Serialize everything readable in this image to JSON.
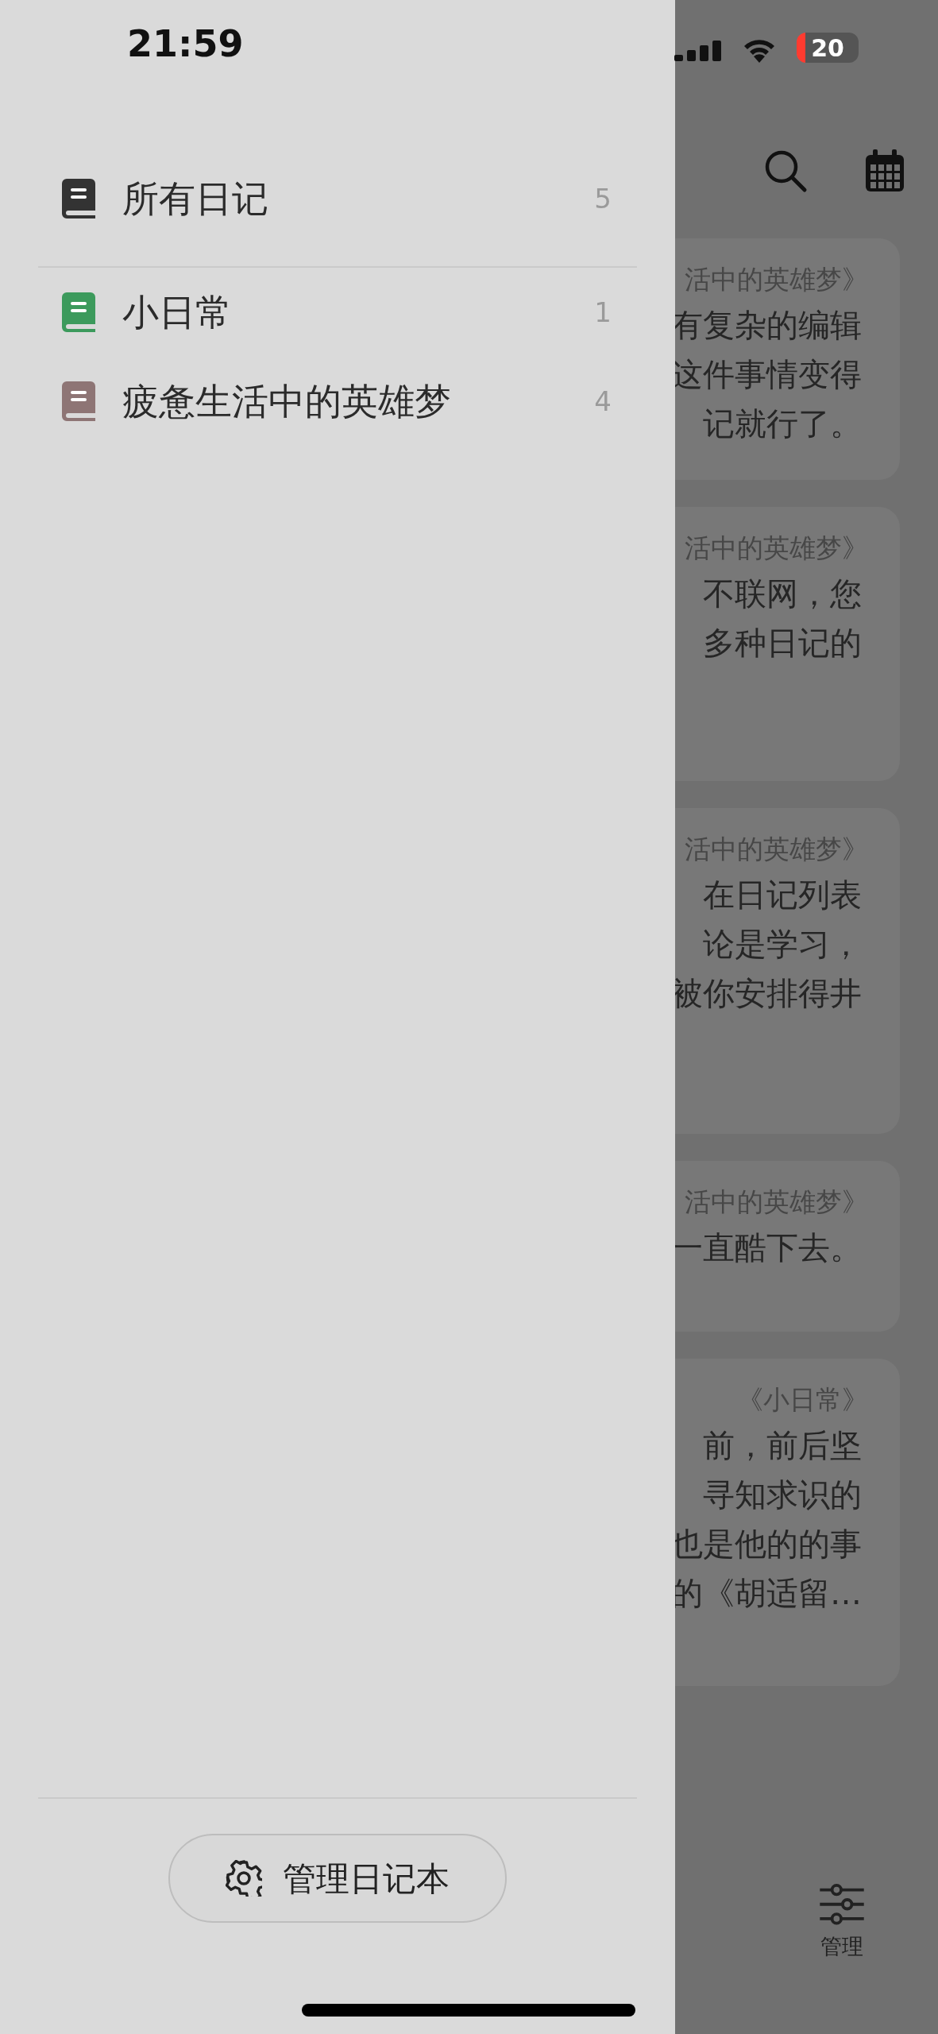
{
  "status_bar": {
    "time": "21:59",
    "battery": "20"
  },
  "entries": [
    {
      "notebook": "活中的英雄梦》",
      "lines": [
        "有复杂的编辑",
        "这件事情变得",
        "记就行了。"
      ]
    },
    {
      "notebook": "活中的英雄梦》",
      "lines": [
        "不联网，您",
        "多种日记的"
      ]
    },
    {
      "notebook": "活中的英雄梦》",
      "lines": [
        "在日记列表",
        "论是学习，",
        "被你安排得井"
      ]
    },
    {
      "notebook": "活中的英雄梦》",
      "lines": [
        "一直酷下去。"
      ]
    },
    {
      "notebook": "《小日常》",
      "lines": [
        "前，前后坚",
        "寻知求识的",
        "也是他的的事",
        "的《胡适留…"
      ]
    }
  ],
  "tab_bar": {
    "label": "管理"
  },
  "drawer": {
    "notebooks": [
      {
        "title": "所有日记",
        "count": "5",
        "color": "#333333"
      },
      {
        "title": "小日常",
        "count": "1",
        "color": "#3c9a5c"
      },
      {
        "title": "疲惫生活中的英雄梦",
        "count": "4",
        "color": "#8e7575"
      }
    ],
    "manage_button": "管理日记本"
  }
}
